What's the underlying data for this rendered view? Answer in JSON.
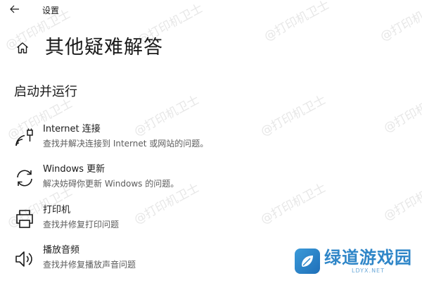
{
  "window": {
    "title": "设置"
  },
  "page": {
    "title": "其他疑难解答",
    "section_title": "启动并运行"
  },
  "items": [
    {
      "name": "Internet 连接",
      "desc": "查找并解决连接到 Internet 或网站的问题。",
      "icon": "wifi-ethernet-icon"
    },
    {
      "name": "Windows 更新",
      "desc": "解决妨碍你更新 Windows 的问题。",
      "icon": "sync-icon"
    },
    {
      "name": "打印机",
      "desc": "查找并修复打印问题",
      "icon": "printer-icon"
    },
    {
      "name": "播放音频",
      "desc": "查找并修复播放声音问题",
      "icon": "speaker-icon"
    }
  ],
  "watermark": {
    "text": "@打印机卫士"
  },
  "logo": {
    "text": "绿道游戏园",
    "sub": "LDYX.NET",
    "color": "#2f86c8"
  }
}
